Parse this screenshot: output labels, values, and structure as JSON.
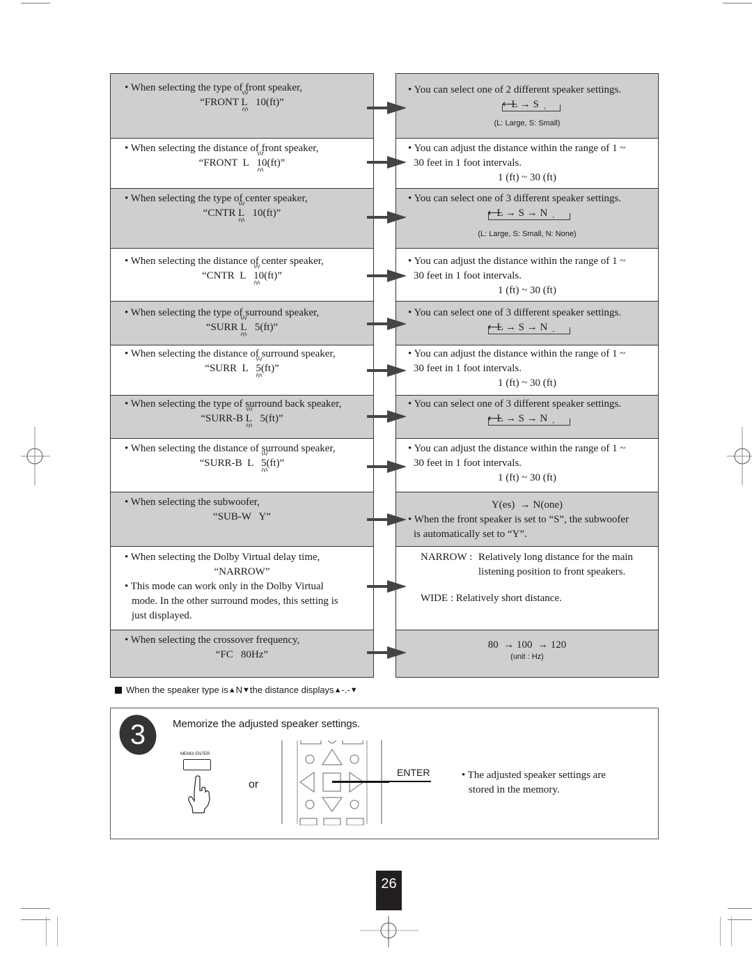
{
  "left_rows": [
    {
      "bullet": "• When selecting the type of front speaker,",
      "display_prefix": "“FRONT ",
      "display_blink": "L",
      "display_suffix": "   10(ft)”"
    },
    {
      "bullet": "• When selecting the distance of front speaker,",
      "display_prefix": "“FRONT  L   ",
      "display_blink": "10",
      "display_suffix": "(ft)”"
    },
    {
      "bullet": "• When selecting the type of center speaker,",
      "display_prefix": "“CNTR ",
      "display_blink": "L",
      "display_suffix": "   10(ft)”"
    },
    {
      "bullet": "• When selecting the distance of center speaker,",
      "display_prefix": "“CNTR  L   ",
      "display_blink": "10",
      "display_suffix": "(ft)”"
    },
    {
      "bullet": "• When selecting the type of surround speaker,",
      "display_prefix": "“SURR ",
      "display_blink": "L",
      "display_suffix": "   5(ft)”"
    },
    {
      "bullet": "• When selecting the distance of surround speaker,",
      "display_prefix": "“SURR  L   ",
      "display_blink": "5",
      "display_suffix": "(ft)”"
    },
    {
      "bullet": "• When selecting the type of surround back speaker,",
      "display_prefix": "“SURR-B ",
      "display_blink": "L",
      "display_suffix": "   5(ft)”"
    },
    {
      "bullet": "• When selecting the distance of surround speaker,",
      "display_prefix": "“SURR-B  L   ",
      "display_blink": "5",
      "display_suffix": "(ft)”"
    },
    {
      "bullet": "• When selecting the subwoofer,",
      "display_prefix": "“SUB-W   Y”",
      "display_blink": "",
      "display_suffix": ""
    },
    {
      "bullet": "• When selecting the Dolby Virtual delay time,",
      "display_prefix": "“NARROW”",
      "display_blink": "",
      "display_suffix": "",
      "extra_lines": [
        "• This mode can work only in the Dolby Virtual",
        "mode. In the other surround modes, this setting is",
        "just displayed."
      ]
    },
    {
      "bullet": "• When selecting the crossover frequency,",
      "display_prefix": "“FC   80Hz”",
      "display_blink": "",
      "display_suffix": ""
    }
  ],
  "right_rows": {
    "type_two": {
      "text": "• You can select one of 2 different speaker settings.",
      "cycle": "L → S",
      "legend": "(L: Large, S: Small)"
    },
    "type_three": {
      "text": "• You can select one of 3 different speaker settings.",
      "cycle": "L → S → N",
      "legend": "(L: Large, S: Small, N: None)"
    },
    "distance": {
      "line1": "• You can adjust the distance within the range of 1 ~",
      "line2": "30 feet in 1 foot intervals.",
      "range": "1 (ft) ~ 30 (ft)"
    },
    "subwoofer": {
      "cycle": "Y(es)  → N(one)",
      "line1": "• When the front speaker is set to “S”, the subwoofer",
      "line2": "is automatically set to “Y”."
    },
    "dolby": {
      "narrow_label": "NARROW :",
      "narrow_line1": "Relatively long distance for the main",
      "narrow_line2": "listening position to front speakers.",
      "wide": "WIDE : Relatively short distance."
    },
    "crossover": {
      "cycle": "80  → 100  → 120",
      "unit": "(unit : Hz)"
    }
  },
  "note": {
    "part1": "When the speaker type is",
    "part2": "N",
    "part3": "the distance displays",
    "part4": "-.-"
  },
  "step3": {
    "number": "3",
    "title": "Memorize the adjusted speaker settings.",
    "button_label": "MEMO/ ENTER",
    "or": "or",
    "enter_label": "ENTER",
    "desc_line1": "• The adjusted speaker settings are",
    "desc_line2": "stored in the memory."
  },
  "page_number": "26"
}
